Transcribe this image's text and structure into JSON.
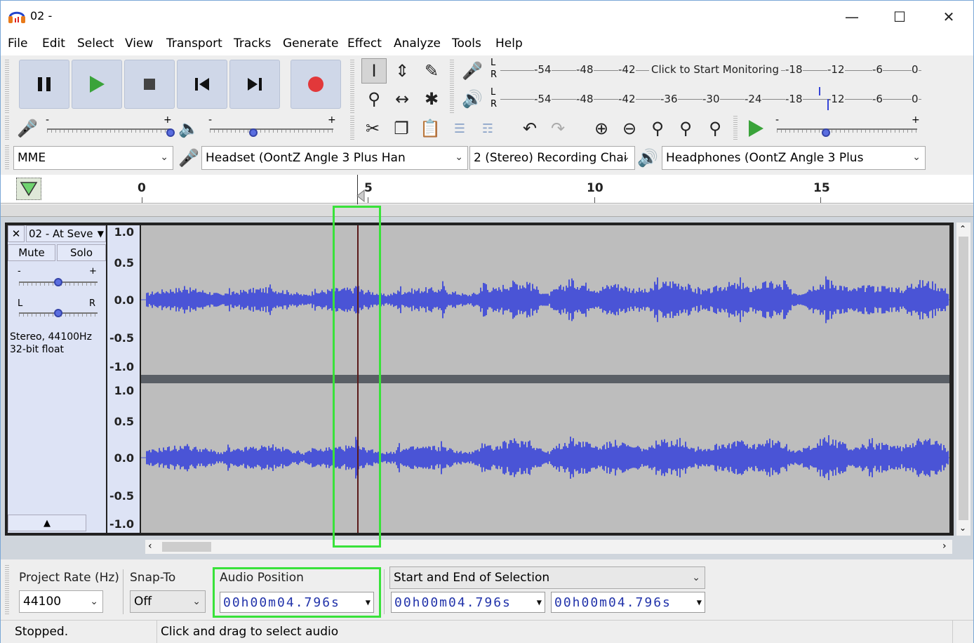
{
  "window": {
    "title": "02 -",
    "minimize_icon": "minimize-icon",
    "maximize_icon": "maximize-icon",
    "close_icon": "close-icon"
  },
  "menu": [
    "File",
    "Edit",
    "Select",
    "View",
    "Transport",
    "Tracks",
    "Generate",
    "Effect",
    "Analyze",
    "Tools",
    "Help"
  ],
  "transport": {
    "buttons": [
      "pause-icon",
      "play-icon",
      "stop-icon",
      "skip-to-start-icon",
      "skip-to-end-icon",
      "record-icon"
    ]
  },
  "meters": {
    "record_scale": [
      "-54",
      "-48",
      "-42",
      "-18",
      "-12",
      "-6",
      "0"
    ],
    "record_prompt": "Click to Start Monitoring",
    "play_scale": [
      "-54",
      "-48",
      "-42",
      "-36",
      "-30",
      "-24",
      "-18",
      "-12",
      "-6",
      "0"
    ],
    "lr": [
      "L",
      "R"
    ]
  },
  "mixer": {
    "minus": "-",
    "plus": "+",
    "record_volume_level": 1.0,
    "playback_volume_level": 0.35
  },
  "play_at_speed_level": 0.35,
  "devices": {
    "host": "MME",
    "recording_device": "Headset (OontZ Angle 3 Plus Han",
    "channels": "2 (Stereo) Recording Chai",
    "playback_device": "Headphones (OontZ Angle 3 Plus"
  },
  "ruler": {
    "labels": [
      "0",
      "5",
      "10",
      "15"
    ]
  },
  "track": {
    "name": "02 - At Seve",
    "mute": "Mute",
    "solo": "Solo",
    "gain_minus": "-",
    "gain_plus": "+",
    "pan_left": "L",
    "pan_right": "R",
    "gain_level": 0.5,
    "pan_level": 0.5,
    "info_line1": "Stereo, 44100Hz",
    "info_line2": "32-bit float",
    "scale_labels": [
      "1.0",
      "0.5",
      "0.0",
      "-0.5",
      "-1.0"
    ]
  },
  "selection_toolbar": {
    "project_rate_label": "Project Rate (Hz)",
    "project_rate_value": "44100",
    "snap_to_label": "Snap-To",
    "snap_to_value": "Off",
    "audio_position_label": "Audio Position",
    "audio_position_value": "00h00m04.796s",
    "selection_mode": "Start and End of Selection",
    "selection_start": "00h00m04.796s",
    "selection_end": "00h00m04.796s"
  },
  "status": {
    "state": "Stopped.",
    "hint": "Click and drag to select audio"
  },
  "colors": {
    "waveform": "#4a54d6",
    "highlight": "#39e23a",
    "record": "#e2383a",
    "play": "#3aa33a"
  }
}
